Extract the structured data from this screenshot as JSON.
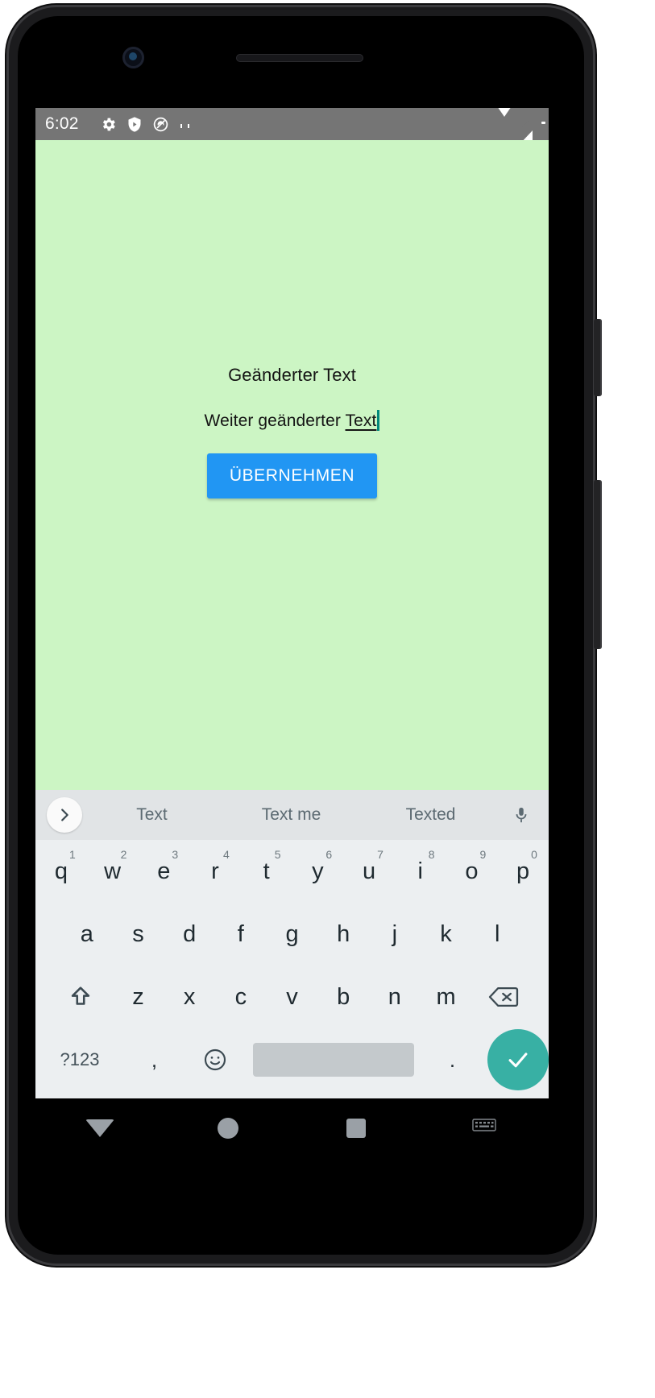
{
  "device": {
    "name": "android-phone"
  },
  "status_bar": {
    "time": "6:02",
    "left_icons": [
      "gear-icon",
      "shield-play-icon",
      "adblock-icon",
      "sd-card-icon"
    ],
    "right_icons": [
      "wifi-icon",
      "cellular-signal-icon",
      "battery-icon"
    ],
    "background": "#757575"
  },
  "app": {
    "background": "#ccf5c4",
    "title_text": "Geänderter Text",
    "edit_text_prefix": "Weiter geänderter ",
    "edit_text_composing": "Text",
    "apply_button_label": "ÜBERNEHMEN",
    "accent_color": "#2196f3",
    "caret_color": "#00897b"
  },
  "keyboard": {
    "background": "#eceff1",
    "suggestion_bar_background": "#e1e4e6",
    "expand_icon": "chevron-right-icon",
    "suggestions": [
      "Text",
      "Text me",
      "Texted"
    ],
    "mic_icon": "microphone-icon",
    "row1": [
      {
        "label": "q",
        "num": "1"
      },
      {
        "label": "w",
        "num": "2"
      },
      {
        "label": "e",
        "num": "3"
      },
      {
        "label": "r",
        "num": "4"
      },
      {
        "label": "t",
        "num": "5"
      },
      {
        "label": "y",
        "num": "6"
      },
      {
        "label": "u",
        "num": "7"
      },
      {
        "label": "i",
        "num": "8"
      },
      {
        "label": "o",
        "num": "9"
      },
      {
        "label": "p",
        "num": "0"
      }
    ],
    "row2": [
      "a",
      "s",
      "d",
      "f",
      "g",
      "h",
      "j",
      "k",
      "l"
    ],
    "row3": [
      "z",
      "x",
      "c",
      "v",
      "b",
      "n",
      "m"
    ],
    "shift_icon": "shift-up-arrow-icon",
    "backspace_icon": "backspace-delete-icon",
    "symbols_label": "?123",
    "comma_label": ",",
    "emoji_icon": "smiley-face-icon",
    "space_label": "",
    "period_label": ".",
    "enter_icon": "checkmark-icon",
    "enter_color": "#38b0a4"
  },
  "nav_bar": {
    "background": "#000000",
    "items": [
      "back-down-arrow-icon",
      "home-circle-icon",
      "recents-square-icon",
      "hide-keyboard-icon"
    ]
  }
}
